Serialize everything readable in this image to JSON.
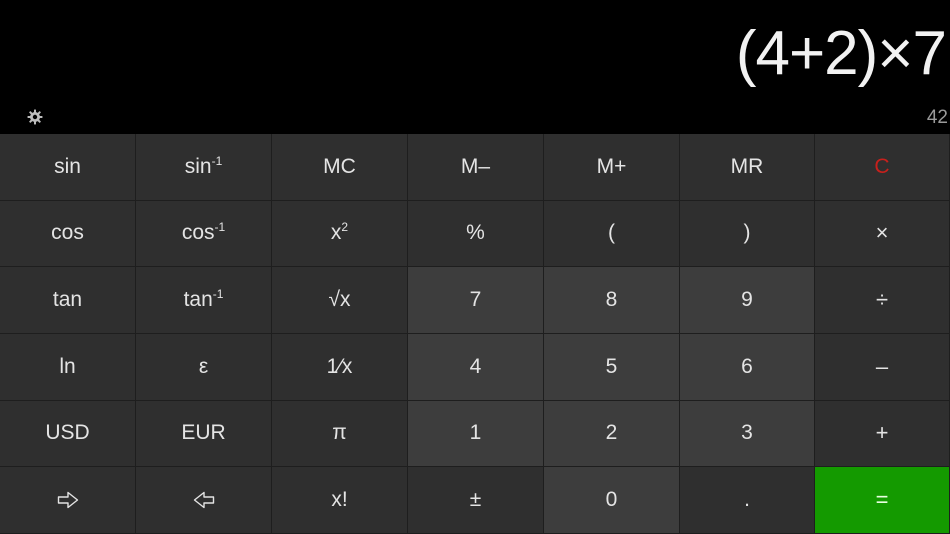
{
  "display": {
    "expression": "(4+2)×7",
    "result": "42"
  },
  "keys": {
    "sin": "sin",
    "asin_base": "sin",
    "asin_sup": "-1",
    "mc": "MC",
    "m_minus": "M–",
    "m_plus": "M+",
    "mr": "MR",
    "clear": "C",
    "cos": "cos",
    "acos_base": "cos",
    "acos_sup": "-1",
    "square_base": "x",
    "square_sup": "2",
    "percent": "%",
    "paren_open": "(",
    "paren_close": ")",
    "multiply": "×",
    "tan": "tan",
    "atan_base": "tan",
    "atan_sup": "-1",
    "sqrt": "√x",
    "seven": "7",
    "eight": "8",
    "nine": "9",
    "divide": "÷",
    "ln": "ln",
    "epsilon": "ε",
    "reciprocal": "1⁄x",
    "four": "4",
    "five": "5",
    "six": "6",
    "minus": "–",
    "usd": "USD",
    "eur": "EUR",
    "pi": "π",
    "one": "1",
    "two": "2",
    "three": "3",
    "plus": "+",
    "factorial": "x!",
    "plus_minus": "±",
    "zero": "0",
    "decimal": ".",
    "equals": "="
  },
  "icons": {
    "settings": "gear-icon",
    "convert_forward": "arrow-right-icon",
    "convert_back": "arrow-left-icon"
  },
  "colors": {
    "equals_bg": "#149a00",
    "clear_text": "#c8201c",
    "number_key_bg": "#3d3d3d",
    "function_key_bg": "#2f2f2f"
  }
}
